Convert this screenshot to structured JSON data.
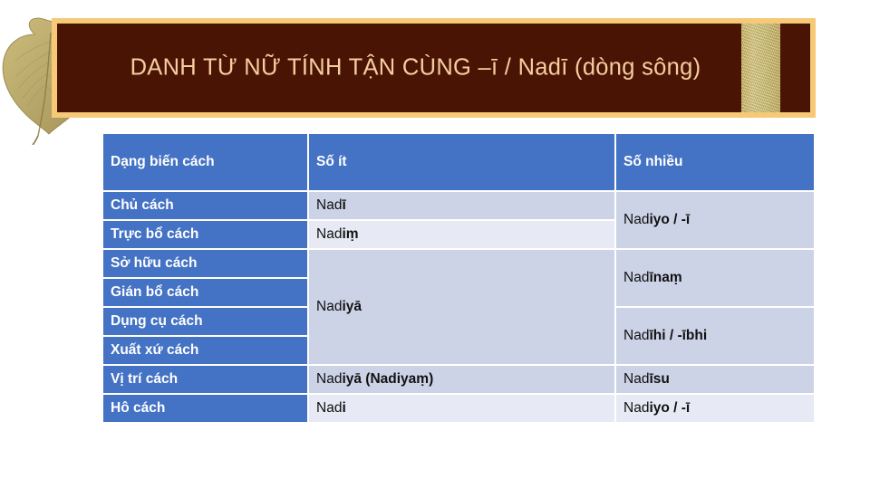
{
  "slide": {
    "title": "DANH TỪ NỮ TÍNH TẬN CÙNG –ī / Nadī (dòng sông)",
    "leaf_icon": "bodhi-leaf-icon",
    "colors": {
      "banner_background": "#4a1404",
      "banner_border": "#f6c977",
      "title_text": "#f6cda0",
      "table_header": "#4472c4",
      "row_shade_a": "#ccd3e7",
      "row_shade_b": "#e7eaf4",
      "gold_strip": "#ded07f"
    }
  },
  "table": {
    "headers": {
      "case": "Dạng biến cách",
      "singular": "Số ít",
      "plural": "Số nhiều"
    },
    "cases": [
      {
        "label": "Chủ cách"
      },
      {
        "label": "Trực bổ cách"
      },
      {
        "label": "Sở hữu cách"
      },
      {
        "label": "Gián bổ cách"
      },
      {
        "label": "Dụng cụ cách"
      },
      {
        "label": "Xuất xứ cách"
      },
      {
        "label": "Vị trí cách"
      },
      {
        "label": "Hô cách"
      }
    ],
    "singular": [
      {
        "value": "Nadī",
        "stem": "Nad",
        "ending": "ī",
        "rowspan": 1
      },
      {
        "value": "Nadiṃ",
        "stem": "Nad",
        "ending": "iṃ",
        "rowspan": 1
      },
      {
        "value": "Nadiyā",
        "stem": "Nad",
        "ending": "iyā",
        "rowspan": 4
      },
      {
        "value": "Nadiyā (Nadiyaṃ)",
        "stem": "Nad",
        "ending": "iyā (Nadiyaṃ)",
        "rowspan": 1
      },
      {
        "value": "Nadi",
        "stem": "Nad",
        "ending": "i",
        "rowspan": 1
      }
    ],
    "plural": [
      {
        "value": "Nadiyo / -ī",
        "stem": "Nad",
        "ending": "iyo / -ī",
        "rowspan": 2
      },
      {
        "value": "Nadīnaṃ",
        "stem": "Nad",
        "ending": "īnaṃ",
        "rowspan": 2
      },
      {
        "value": "Nadīhi / -ībhi",
        "stem": "Nad",
        "ending": "īhi / -ībhi",
        "rowspan": 2
      },
      {
        "value": "Nadīsu",
        "stem": "Nad",
        "ending": "īsu",
        "rowspan": 1
      },
      {
        "value": "Nadiyo / -ī",
        "stem": "Nad",
        "ending": "iyo / -ī",
        "rowspan": 1
      }
    ]
  }
}
